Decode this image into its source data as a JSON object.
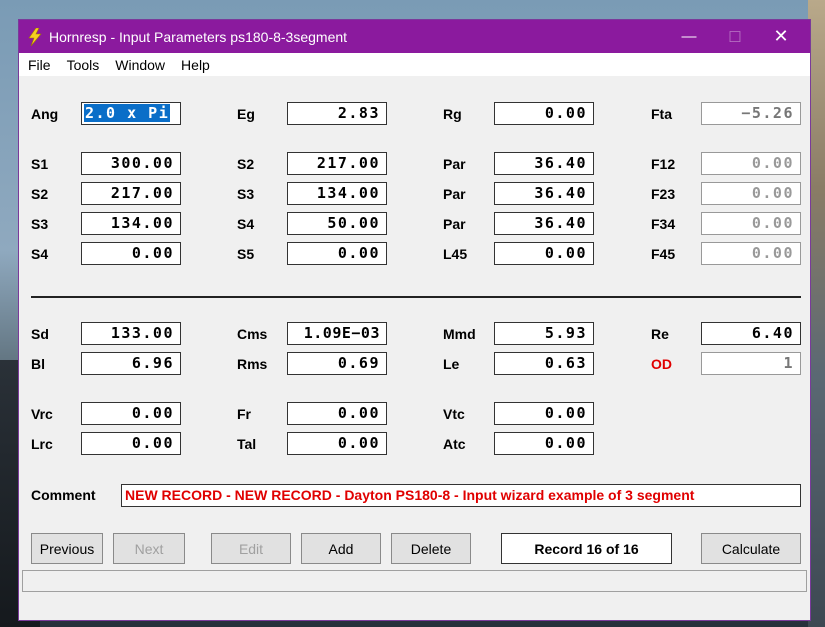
{
  "window": {
    "title": "Hornresp - Input Parameters   ps180-8-3segment",
    "minimize": "—",
    "maximize": "☐",
    "close": "✕"
  },
  "menu": [
    "File",
    "Tools",
    "Window",
    "Help"
  ],
  "row_ang": {
    "ang_label": "Ang",
    "ang": "2.0 x Pi",
    "eg_label": "Eg",
    "eg": "2.83",
    "rg_label": "Rg",
    "rg": "0.00",
    "fta_label": "Fta",
    "fta": "−5.26"
  },
  "horn": [
    {
      "s_label": "S1",
      "s": "300.00",
      "s2_label": "S2",
      "s2": "217.00",
      "par_label": "Par",
      "par": "36.40",
      "f_label": "F12",
      "f": "0.00"
    },
    {
      "s_label": "S2",
      "s": "217.00",
      "s2_label": "S3",
      "s2": "134.00",
      "par_label": "Par",
      "par": "36.40",
      "f_label": "F23",
      "f": "0.00"
    },
    {
      "s_label": "S3",
      "s": "134.00",
      "s2_label": "S4",
      "s2": "50.00",
      "par_label": "Par",
      "par": "36.40",
      "f_label": "F34",
      "f": "0.00"
    },
    {
      "s_label": "S4",
      "s": "0.00",
      "s2_label": "S5",
      "s2": "0.00",
      "par_label": "L45",
      "par": "0.00",
      "f_label": "F45",
      "f": "0.00"
    }
  ],
  "driver": {
    "sd_label": "Sd",
    "sd": "133.00",
    "cms_label": "Cms",
    "cms": "1.09E−03",
    "mmd_label": "Mmd",
    "mmd": "5.93",
    "re_label": "Re",
    "re": "6.40",
    "bl_label": "Bl",
    "bl": "6.96",
    "rms_label": "Rms",
    "rms": "0.69",
    "le_label": "Le",
    "le": "0.63",
    "od_label": "OD",
    "od": "1"
  },
  "chambers": {
    "vrc_label": "Vrc",
    "vrc": "0.00",
    "fr_label": "Fr",
    "fr": "0.00",
    "vtc_label": "Vtc",
    "vtc": "0.00",
    "lrc_label": "Lrc",
    "lrc": "0.00",
    "tal_label": "Tal",
    "tal": "0.00",
    "atc_label": "Atc",
    "atc": "0.00"
  },
  "comment_label": "Comment",
  "comment": "NEW RECORD - NEW RECORD - Dayton PS180-8 - Input wizard example of 3 segment",
  "buttons": {
    "previous": "Previous",
    "next": "Next",
    "edit": "Edit",
    "add": "Add",
    "delete": "Delete",
    "calculate": "Calculate"
  },
  "record": "Record 16 of 16",
  "colors": {
    "titlebar": "#8b1a9e",
    "accent_red": "#e00000",
    "selection": "#0a6ec8"
  },
  "icons": {
    "app": "lightning-bolt-icon"
  }
}
